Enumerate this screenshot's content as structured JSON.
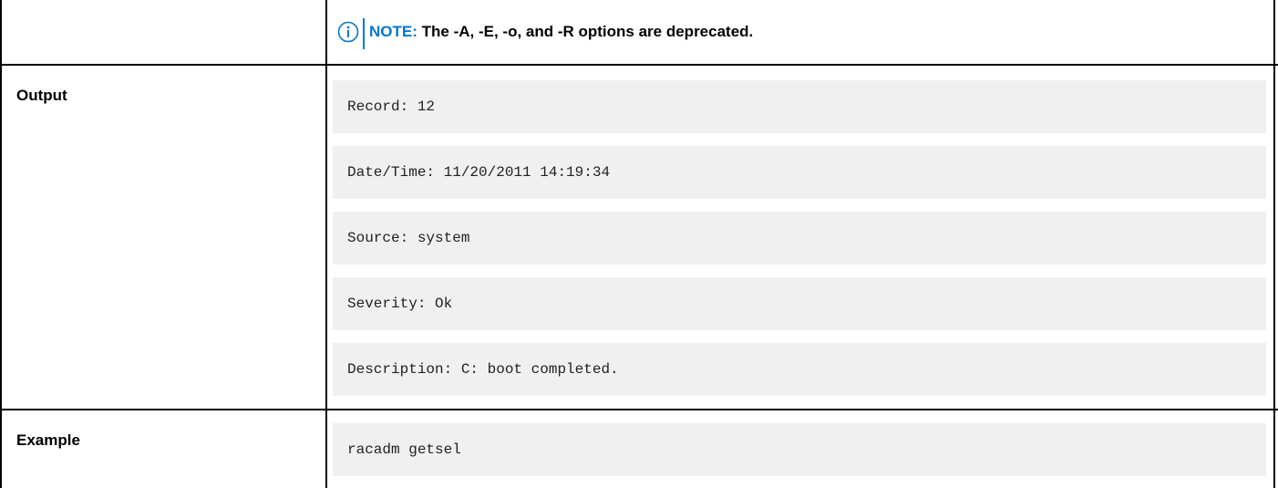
{
  "note": {
    "label": "NOTE:",
    "text": "The -A, -E, -o, and -R options are deprecated.",
    "icon": "info-icon",
    "accent_color": "#0076ce"
  },
  "rows": {
    "output": {
      "label": "Output",
      "lines": [
        "Record: 12",
        "Date/Time: 11/20/2011 14:19:34",
        "Source: system",
        "Severity: Ok",
        "Description: C: boot completed."
      ]
    },
    "example": {
      "label": "Example",
      "code": "racadm getsel"
    }
  },
  "colors": {
    "code_background": "#f0f0f0",
    "rule": "#000000"
  }
}
